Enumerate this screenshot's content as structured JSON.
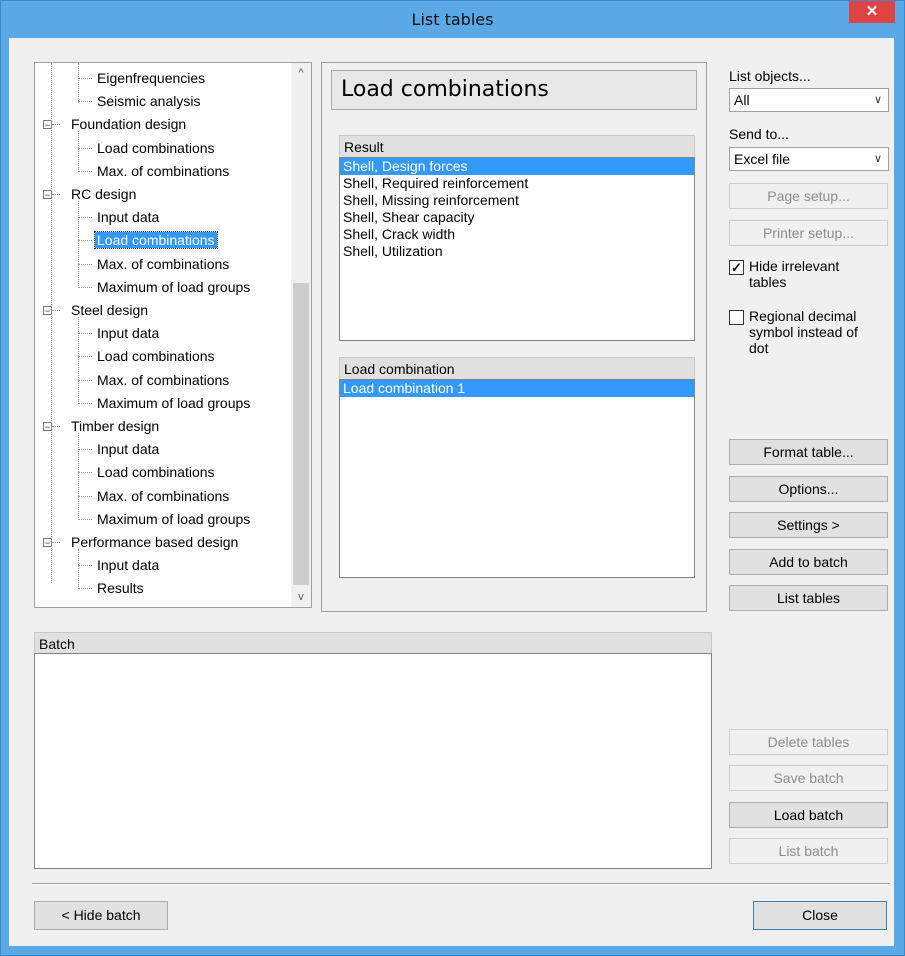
{
  "window": {
    "title": "List tables",
    "close_glyph": "✕"
  },
  "tree": {
    "items": [
      {
        "label": "Eigenfrequencies",
        "level": 2,
        "expander": ""
      },
      {
        "label": "Seismic analysis",
        "level": 2,
        "expander": ""
      },
      {
        "label": "Foundation design",
        "level": 1,
        "expander": "⊟"
      },
      {
        "label": "Load combinations",
        "level": 2,
        "expander": ""
      },
      {
        "label": "Max. of combinations",
        "level": 2,
        "expander": ""
      },
      {
        "label": "RC design",
        "level": 1,
        "expander": "⊟"
      },
      {
        "label": "Input data",
        "level": 2,
        "expander": ""
      },
      {
        "label": "Load combinations",
        "level": 2,
        "expander": "",
        "selected": true
      },
      {
        "label": "Max. of combinations",
        "level": 2,
        "expander": ""
      },
      {
        "label": "Maximum of load groups",
        "level": 2,
        "expander": ""
      },
      {
        "label": "Steel design",
        "level": 1,
        "expander": "⊟"
      },
      {
        "label": "Input data",
        "level": 2,
        "expander": ""
      },
      {
        "label": "Load combinations",
        "level": 2,
        "expander": ""
      },
      {
        "label": "Max. of combinations",
        "level": 2,
        "expander": ""
      },
      {
        "label": "Maximum of load groups",
        "level": 2,
        "expander": ""
      },
      {
        "label": "Timber design",
        "level": 1,
        "expander": "⊟"
      },
      {
        "label": "Input data",
        "level": 2,
        "expander": ""
      },
      {
        "label": "Load combinations",
        "level": 2,
        "expander": ""
      },
      {
        "label": "Max. of combinations",
        "level": 2,
        "expander": ""
      },
      {
        "label": "Maximum of load groups",
        "level": 2,
        "expander": ""
      },
      {
        "label": "Performance based design",
        "level": 1,
        "expander": "⊟"
      },
      {
        "label": "Input data",
        "level": 2,
        "expander": ""
      },
      {
        "label": "Results",
        "level": 2,
        "expander": ""
      }
    ],
    "scroll_up": "^",
    "scroll_down": "v"
  },
  "main": {
    "heading": "Load combinations",
    "result": {
      "header": "Result",
      "items": [
        "Shell, Design forces",
        "Shell, Required reinforcement",
        "Shell, Missing reinforcement",
        "Shell, Shear capacity",
        "Shell, Crack width",
        "Shell, Utilization"
      ],
      "selected_index": 0
    },
    "load_combination": {
      "header": "Load combination",
      "items": [
        "Load combination 1"
      ],
      "selected_index": 0
    }
  },
  "right": {
    "list_objects_label": "List objects...",
    "list_objects_value": "All",
    "send_to_label": "Send to...",
    "send_to_value": "Excel file",
    "page_setup": "Page setup...",
    "printer_setup": "Printer setup...",
    "hide_irrelevant": {
      "label_line1": "Hide irrelevant",
      "label_line2": "tables",
      "checked": true
    },
    "regional": {
      "label_line1": "Regional decimal",
      "label_line2": "symbol instead of",
      "label_line3": "dot",
      "checked": false
    },
    "format_table": "Format table...",
    "options": "Options...",
    "settings": "Settings >",
    "add_to_batch": "Add to batch",
    "list_tables": "List tables",
    "delete_tables": "Delete tables",
    "save_batch": "Save batch",
    "load_batch": "Load batch",
    "list_batch": "List batch"
  },
  "batch": {
    "header": "Batch"
  },
  "bottom": {
    "hide_batch": "< Hide batch",
    "close": "Close"
  },
  "colors": {
    "title_bar": "#5aa8e6",
    "selection": "#3399ff",
    "close_button": "#e04343"
  }
}
